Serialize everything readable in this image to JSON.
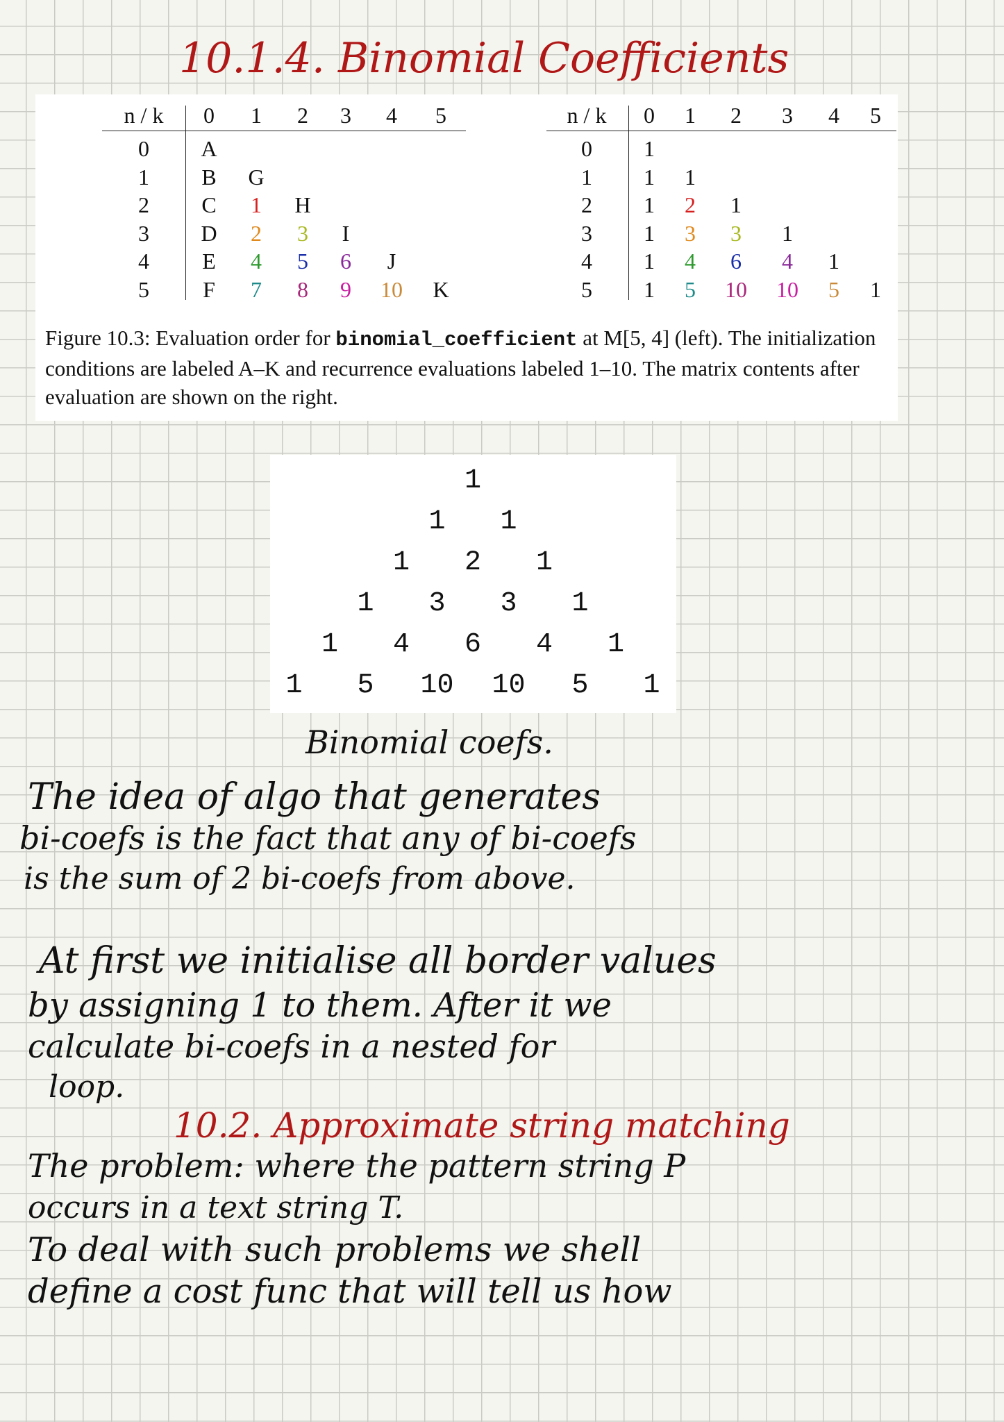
{
  "title": "10.1.4. Binomial Coefficients",
  "figure": {
    "left_matrix": {
      "header_label": "n / k",
      "columns": [
        "0",
        "1",
        "2",
        "3",
        "4",
        "5"
      ],
      "rows": [
        {
          "n": "0",
          "cells": [
            {
              "t": "A",
              "c": "#111111"
            }
          ]
        },
        {
          "n": "1",
          "cells": [
            {
              "t": "B",
              "c": "#111111"
            },
            {
              "t": "G",
              "c": "#111111"
            }
          ]
        },
        {
          "n": "2",
          "cells": [
            {
              "t": "C",
              "c": "#111111"
            },
            {
              "t": "1",
              "c": "#d62020"
            },
            {
              "t": "H",
              "c": "#111111"
            }
          ]
        },
        {
          "n": "3",
          "cells": [
            {
              "t": "D",
              "c": "#111111"
            },
            {
              "t": "2",
              "c": "#e08a1e"
            },
            {
              "t": "3",
              "c": "#a8b820"
            },
            {
              "t": "I",
              "c": "#111111"
            }
          ]
        },
        {
          "n": "4",
          "cells": [
            {
              "t": "E",
              "c": "#111111"
            },
            {
              "t": "4",
              "c": "#2e9a2e"
            },
            {
              "t": "5",
              "c": "#1a2fa8"
            },
            {
              "t": "6",
              "c": "#8a2a9a"
            },
            {
              "t": "J",
              "c": "#111111"
            }
          ]
        },
        {
          "n": "5",
          "cells": [
            {
              "t": "F",
              "c": "#111111"
            },
            {
              "t": "7",
              "c": "#1f8a8a"
            },
            {
              "t": "8",
              "c": "#a8287a"
            },
            {
              "t": "9",
              "c": "#c81ea0"
            },
            {
              "t": "10",
              "c": "#c98a3a"
            },
            {
              "t": "K",
              "c": "#111111"
            }
          ]
        }
      ]
    },
    "right_matrix": {
      "header_label": "n / k",
      "columns": [
        "0",
        "1",
        "2",
        "3",
        "4",
        "5"
      ],
      "rows": [
        {
          "n": "0",
          "cells": [
            {
              "t": "1",
              "c": "#111111"
            }
          ]
        },
        {
          "n": "1",
          "cells": [
            {
              "t": "1",
              "c": "#111111"
            },
            {
              "t": "1",
              "c": "#111111"
            }
          ]
        },
        {
          "n": "2",
          "cells": [
            {
              "t": "1",
              "c": "#111111"
            },
            {
              "t": "2",
              "c": "#d62020"
            },
            {
              "t": "1",
              "c": "#111111"
            }
          ]
        },
        {
          "n": "3",
          "cells": [
            {
              "t": "1",
              "c": "#111111"
            },
            {
              "t": "3",
              "c": "#e08a1e"
            },
            {
              "t": "3",
              "c": "#a8b820"
            },
            {
              "t": "1",
              "c": "#111111"
            }
          ]
        },
        {
          "n": "4",
          "cells": [
            {
              "t": "1",
              "c": "#111111"
            },
            {
              "t": "4",
              "c": "#2e9a2e"
            },
            {
              "t": "6",
              "c": "#1a2fa8"
            },
            {
              "t": "4",
              "c": "#8a2a9a"
            },
            {
              "t": "1",
              "c": "#111111"
            }
          ]
        },
        {
          "n": "5",
          "cells": [
            {
              "t": "1",
              "c": "#111111"
            },
            {
              "t": "5",
              "c": "#1f8a8a"
            },
            {
              "t": "10",
              "c": "#a8287a"
            },
            {
              "t": "10",
              "c": "#c81ea0"
            },
            {
              "t": "5",
              "c": "#c98a3a"
            },
            {
              "t": "1",
              "c": "#111111"
            }
          ]
        }
      ]
    },
    "caption_prefix": "Figure 10.3: Evaluation order for",
    "caption_code": "binomial_coefficient",
    "caption_suffix": "at M[5, 4] (left). The initialization conditions are labeled A–K and recurrence evaluations labeled 1–10. The matrix contents after evaluation are shown on the right."
  },
  "triangle": [
    [
      "1"
    ],
    [
      "1",
      "1"
    ],
    [
      "1",
      "2",
      "1"
    ],
    [
      "1",
      "3",
      "3",
      "1"
    ],
    [
      "1",
      "4",
      "6",
      "4",
      "1"
    ],
    [
      "1",
      "5",
      "10",
      "10",
      "5",
      "1"
    ]
  ],
  "triangle_label": "Binomial coefs.",
  "notes": [
    "The idea of algo that generates",
    "bi-coefs is the fact that any of bi-coefs",
    "is the sum of 2 bi-coefs from above.",
    "At first we initialise all border values",
    "by assigning 1 to them. After it we",
    "calculate bi-coefs in a nested for",
    "loop.",
    "10.2. Approximate string matching",
    "The problem: where the pattern string P",
    "occurs in a text string T.",
    "To deal with such problems we shell",
    "define a cost func that will tell us how"
  ]
}
